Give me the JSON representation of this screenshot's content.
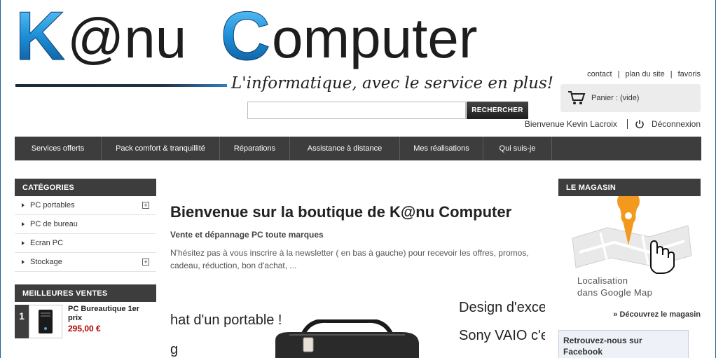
{
  "brand": {
    "logo_text": "K@nu Computer",
    "tagline": "L'informatique, avec le service en plus!"
  },
  "top_links": [
    "contact",
    "plan du site",
    "favoris"
  ],
  "cart": {
    "label": "Panier : (vide)"
  },
  "search": {
    "placeholder": "",
    "value": "",
    "button_label": "RECHERCHER"
  },
  "user": {
    "greeting": "Bienvenue Kevin Lacroix",
    "logout_label": "Déconnexion"
  },
  "nav": {
    "items": [
      "Services offerts",
      "Pack comfort & tranquillité",
      "Réparations",
      "Assistance à distance",
      "Mes réalisations",
      "Qui suis-je"
    ]
  },
  "sidebar_left": {
    "categories_title": "CATÉGORIES",
    "categories": [
      {
        "label": "PC portables",
        "expandable": true
      },
      {
        "label": "PC de bureau",
        "expandable": false
      },
      {
        "label": "Ecran PC",
        "expandable": false
      },
      {
        "label": "Stockage",
        "expandable": true
      }
    ],
    "best_title": "MEILLEURES VENTES",
    "best": [
      {
        "rank": "1",
        "name": "PC Bureautique 1er prix",
        "price": "295,00 €"
      }
    ]
  },
  "sidebar_right": {
    "store_title": "LE MAGASIN",
    "map_caption_line1": "Localisation",
    "map_caption_line2": "dans Google Map",
    "store_link": "» Découvrez le magasin",
    "facebook_title": "Retrouvez-nous sur Facebook"
  },
  "main": {
    "title": "Bienvenue sur la boutique de K@nu Computer",
    "subtitle": "Vente et dépannage PC toute marques",
    "text": "N'hésitez pas à vous inscrire à la newsletter ( en bas à gauche) pour recevoir les offres, promos, cadeau, réduction, bon d'achat, ..."
  },
  "banner": {
    "line1": "hat d'un portable !",
    "line2": "g",
    "line3": "Design d'excep",
    "line4": "Sony VAIO c'e"
  },
  "colors": {
    "nav_bg": "#3d3d3d",
    "logo_blue": "#1e8fd8",
    "price_red": "#b00000"
  }
}
